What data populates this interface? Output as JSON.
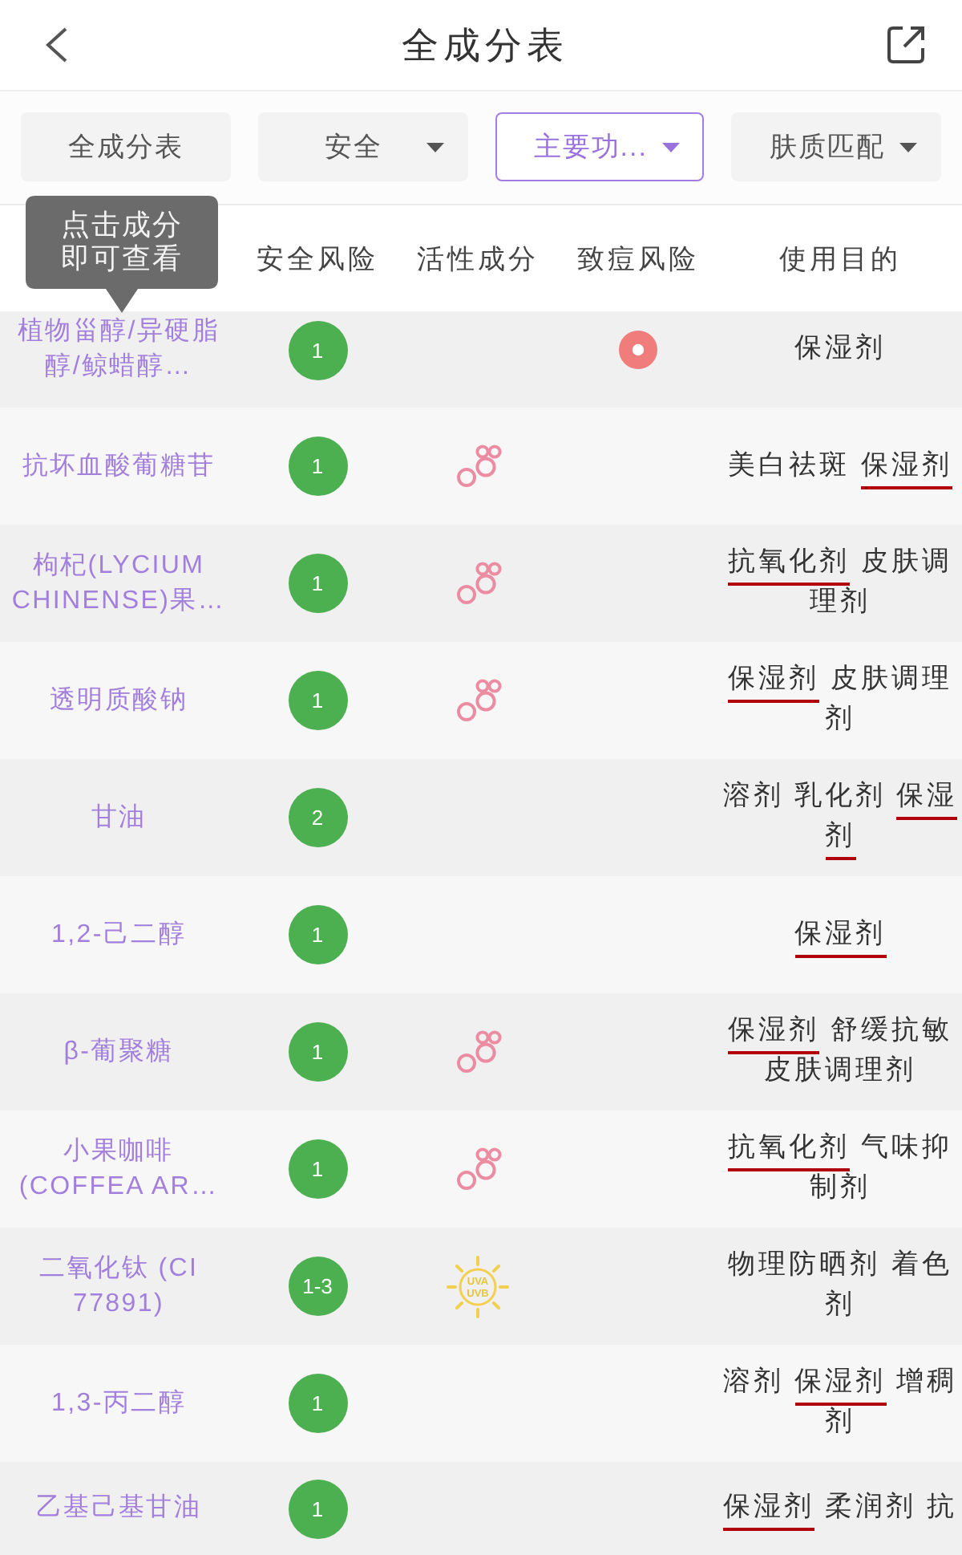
{
  "nav": {
    "title": "全成分表"
  },
  "filters": [
    {
      "label": "全成分表",
      "selected": false,
      "dropdown": false
    },
    {
      "label": "安全",
      "selected": false,
      "dropdown": true
    },
    {
      "label": "主要功...",
      "selected": true,
      "dropdown": true
    },
    {
      "label": "肤质匹配",
      "selected": false,
      "dropdown": true
    }
  ],
  "tooltip": "点击成分即可查看",
  "table": {
    "columns": [
      "安全风险",
      "活性成分",
      "致痘风险",
      "使用目的"
    ],
    "rows": [
      {
        "name": "植物甾醇/异硬脂醇/鲸蜡醇…",
        "safety": "1",
        "acne": true,
        "purposes": [
          {
            "text": "保湿剂",
            "underlined": false
          }
        ]
      },
      {
        "name": "抗坏血酸葡糖苷",
        "safety": "1",
        "active": {
          "kind": "molecule"
        },
        "acne": false,
        "purposes": [
          {
            "text": "美白祛斑",
            "underlined": false
          },
          {
            "text": "保湿剂",
            "underlined": true
          }
        ]
      },
      {
        "name": "枸杞(LYCIUM CHINENSE)果…",
        "safety": "1",
        "active": {
          "kind": "molecule"
        },
        "acne": false,
        "purposes": [
          {
            "text": "抗氧化剂",
            "underlined": true
          },
          {
            "text": "皮肤调理剂",
            "underlined": false
          }
        ]
      },
      {
        "name": "透明质酸钠",
        "safety": "1",
        "active": {
          "kind": "molecule"
        },
        "acne": false,
        "purposes": [
          {
            "text": "保湿剂",
            "underlined": true
          },
          {
            "text": "皮肤调理剂",
            "underlined": false
          }
        ]
      },
      {
        "name": "甘油",
        "safety": "2",
        "acne": false,
        "purposes": [
          {
            "text": "溶剂",
            "underlined": false
          },
          {
            "text": "乳化剂",
            "underlined": false
          },
          {
            "text": "保湿剂",
            "underlined": true
          }
        ]
      },
      {
        "name": "1,2-己二醇",
        "safety": "1",
        "acne": false,
        "purposes": [
          {
            "text": "保湿剂",
            "underlined": true
          }
        ]
      },
      {
        "name": "β-葡聚糖",
        "safety": "1",
        "active": {
          "kind": "molecule"
        },
        "acne": false,
        "purposes": [
          {
            "text": "保湿剂",
            "underlined": true
          },
          {
            "text": "舒缓抗敏",
            "underlined": false
          },
          {
            "text": "皮肤调理剂",
            "underlined": false
          }
        ]
      },
      {
        "name": "小果咖啡(COFFEA AR…",
        "safety": "1",
        "active": {
          "kind": "molecule"
        },
        "acne": false,
        "purposes": [
          {
            "text": "抗氧化剂",
            "underlined": true
          },
          {
            "text": "气味抑制剂",
            "underlined": false
          }
        ]
      },
      {
        "name": "二氧化钛 (CI 77891)",
        "safety": "1-3",
        "active": {
          "kind": "uv",
          "labels": [
            "UVA",
            "UVB"
          ]
        },
        "acne": false,
        "purposes": [
          {
            "text": "物理防晒剂",
            "underlined": false
          },
          {
            "text": "着色剂",
            "underlined": false
          }
        ]
      },
      {
        "name": "1,3-丙二醇",
        "safety": "1",
        "acne": false,
        "purposes": [
          {
            "text": "溶剂",
            "underlined": false
          },
          {
            "text": "保湿剂",
            "underlined": true
          },
          {
            "text": "增稠剂",
            "underlined": false
          }
        ]
      },
      {
        "name": "乙基己基甘油",
        "safety": "1",
        "acne": false,
        "purposes": [
          {
            "text": "保湿剂",
            "underlined": true
          },
          {
            "text": "柔润剂",
            "underlined": false
          },
          {
            "text": "抗",
            "underlined": false
          }
        ]
      }
    ]
  }
}
